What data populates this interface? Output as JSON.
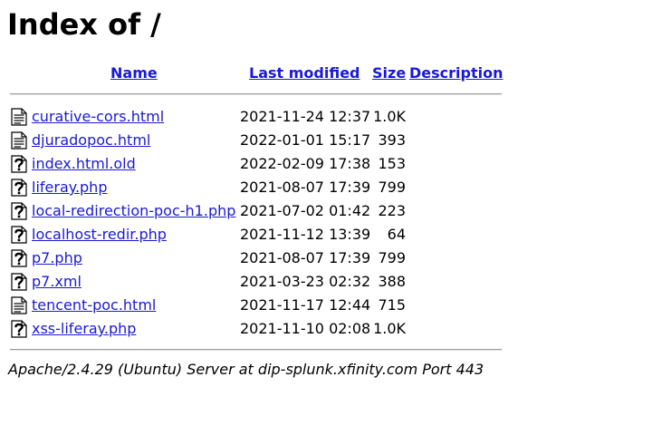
{
  "page_title": "Index of /",
  "table": {
    "headers": {
      "name": "Name",
      "last_modified": "Last modified",
      "size": "Size",
      "description": "Description"
    },
    "rows": [
      {
        "name": "curative-cors.html",
        "modified": "2021-11-24 12:37",
        "size": "1.0K",
        "description": "",
        "icon": "text-file-icon"
      },
      {
        "name": "djuradopoc.html",
        "modified": "2022-01-01 15:17",
        "size": "393",
        "description": "",
        "icon": "text-file-icon"
      },
      {
        "name": "index.html.old",
        "modified": "2022-02-09 17:38",
        "size": "153",
        "description": "",
        "icon": "unknown-file-icon"
      },
      {
        "name": "liferay.php",
        "modified": "2021-08-07 17:39",
        "size": "799",
        "description": "",
        "icon": "unknown-file-icon"
      },
      {
        "name": "local-redirection-poc-h1.php",
        "modified": "2021-07-02 01:42",
        "size": "223",
        "description": "",
        "icon": "unknown-file-icon"
      },
      {
        "name": "localhost-redir.php",
        "modified": "2021-11-12 13:39",
        "size": "64",
        "description": "",
        "icon": "unknown-file-icon"
      },
      {
        "name": "p7.php",
        "modified": "2021-08-07 17:39",
        "size": "799",
        "description": "",
        "icon": "unknown-file-icon"
      },
      {
        "name": "p7.xml",
        "modified": "2021-03-23 02:32",
        "size": "388",
        "description": "",
        "icon": "unknown-file-icon"
      },
      {
        "name": "tencent-poc.html",
        "modified": "2021-11-17 12:44",
        "size": "715",
        "description": "",
        "icon": "text-file-icon"
      },
      {
        "name": "xss-liferay.php",
        "modified": "2021-11-10 02:08",
        "size": "1.0K",
        "description": "",
        "icon": "unknown-file-icon"
      }
    ]
  },
  "footer": {
    "server_signature": "Apache/2.4.29 (Ubuntu) Server at dip-splunk.xfinity.com Port 443"
  },
  "colors": {
    "link": "#1a1ad6",
    "rule": "#9a9a9a"
  }
}
